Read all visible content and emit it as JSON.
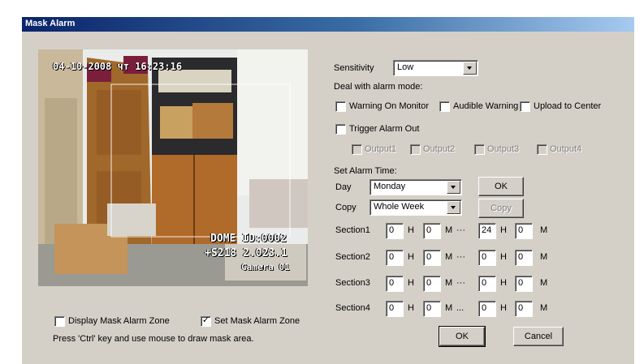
{
  "window": {
    "title": "Mask Alarm"
  },
  "preview": {
    "timestamp": "04-10-2008 чт 16:23:16",
    "dome_id": "DOME ID:0002",
    "dome_code": "+S218 2.023.1",
    "camera_label": "Camera 01"
  },
  "sensitivity": {
    "label": "Sensitivity",
    "value": "Low"
  },
  "deal_mode": {
    "label": "Deal with alarm mode:",
    "warning_on_monitor": "Warning On Monitor",
    "audible_warning": "Audible Warning",
    "upload_to_center": "Upload to Center",
    "trigger_alarm_out": "Trigger Alarm Out",
    "outputs": [
      "Output1",
      "Output2",
      "Output3",
      "Output4"
    ]
  },
  "alarm_time": {
    "label": "Set Alarm Time:",
    "day_label": "Day",
    "day_value": "Monday",
    "copy_label": "Copy",
    "copy_value": "Whole Week",
    "ok_label": "OK",
    "copy_button": "Copy",
    "h_unit": "H",
    "m_unit": "M",
    "sections": [
      {
        "label": "Section1",
        "start_h": "0",
        "start_m": "0",
        "sep": "···",
        "end_h": "24",
        "end_m": "0"
      },
      {
        "label": "Section2",
        "start_h": "0",
        "start_m": "0",
        "sep": "···",
        "end_h": "0",
        "end_m": "0"
      },
      {
        "label": "Section3",
        "start_h": "0",
        "start_m": "0",
        "sep": "···",
        "end_h": "0",
        "end_m": "0"
      },
      {
        "label": "Section4",
        "start_h": "0",
        "start_m": "0",
        "sep": "...",
        "end_h": "0",
        "end_m": "0"
      }
    ]
  },
  "mask": {
    "display_zone": "Display Mask Alarm Zone",
    "display_checked": false,
    "set_zone": "Set Mask Alarm Zone",
    "set_checked": true,
    "hint": "Press 'Ctrl' key and use mouse to draw mask area."
  },
  "buttons": {
    "ok": "OK",
    "cancel": "Cancel"
  }
}
